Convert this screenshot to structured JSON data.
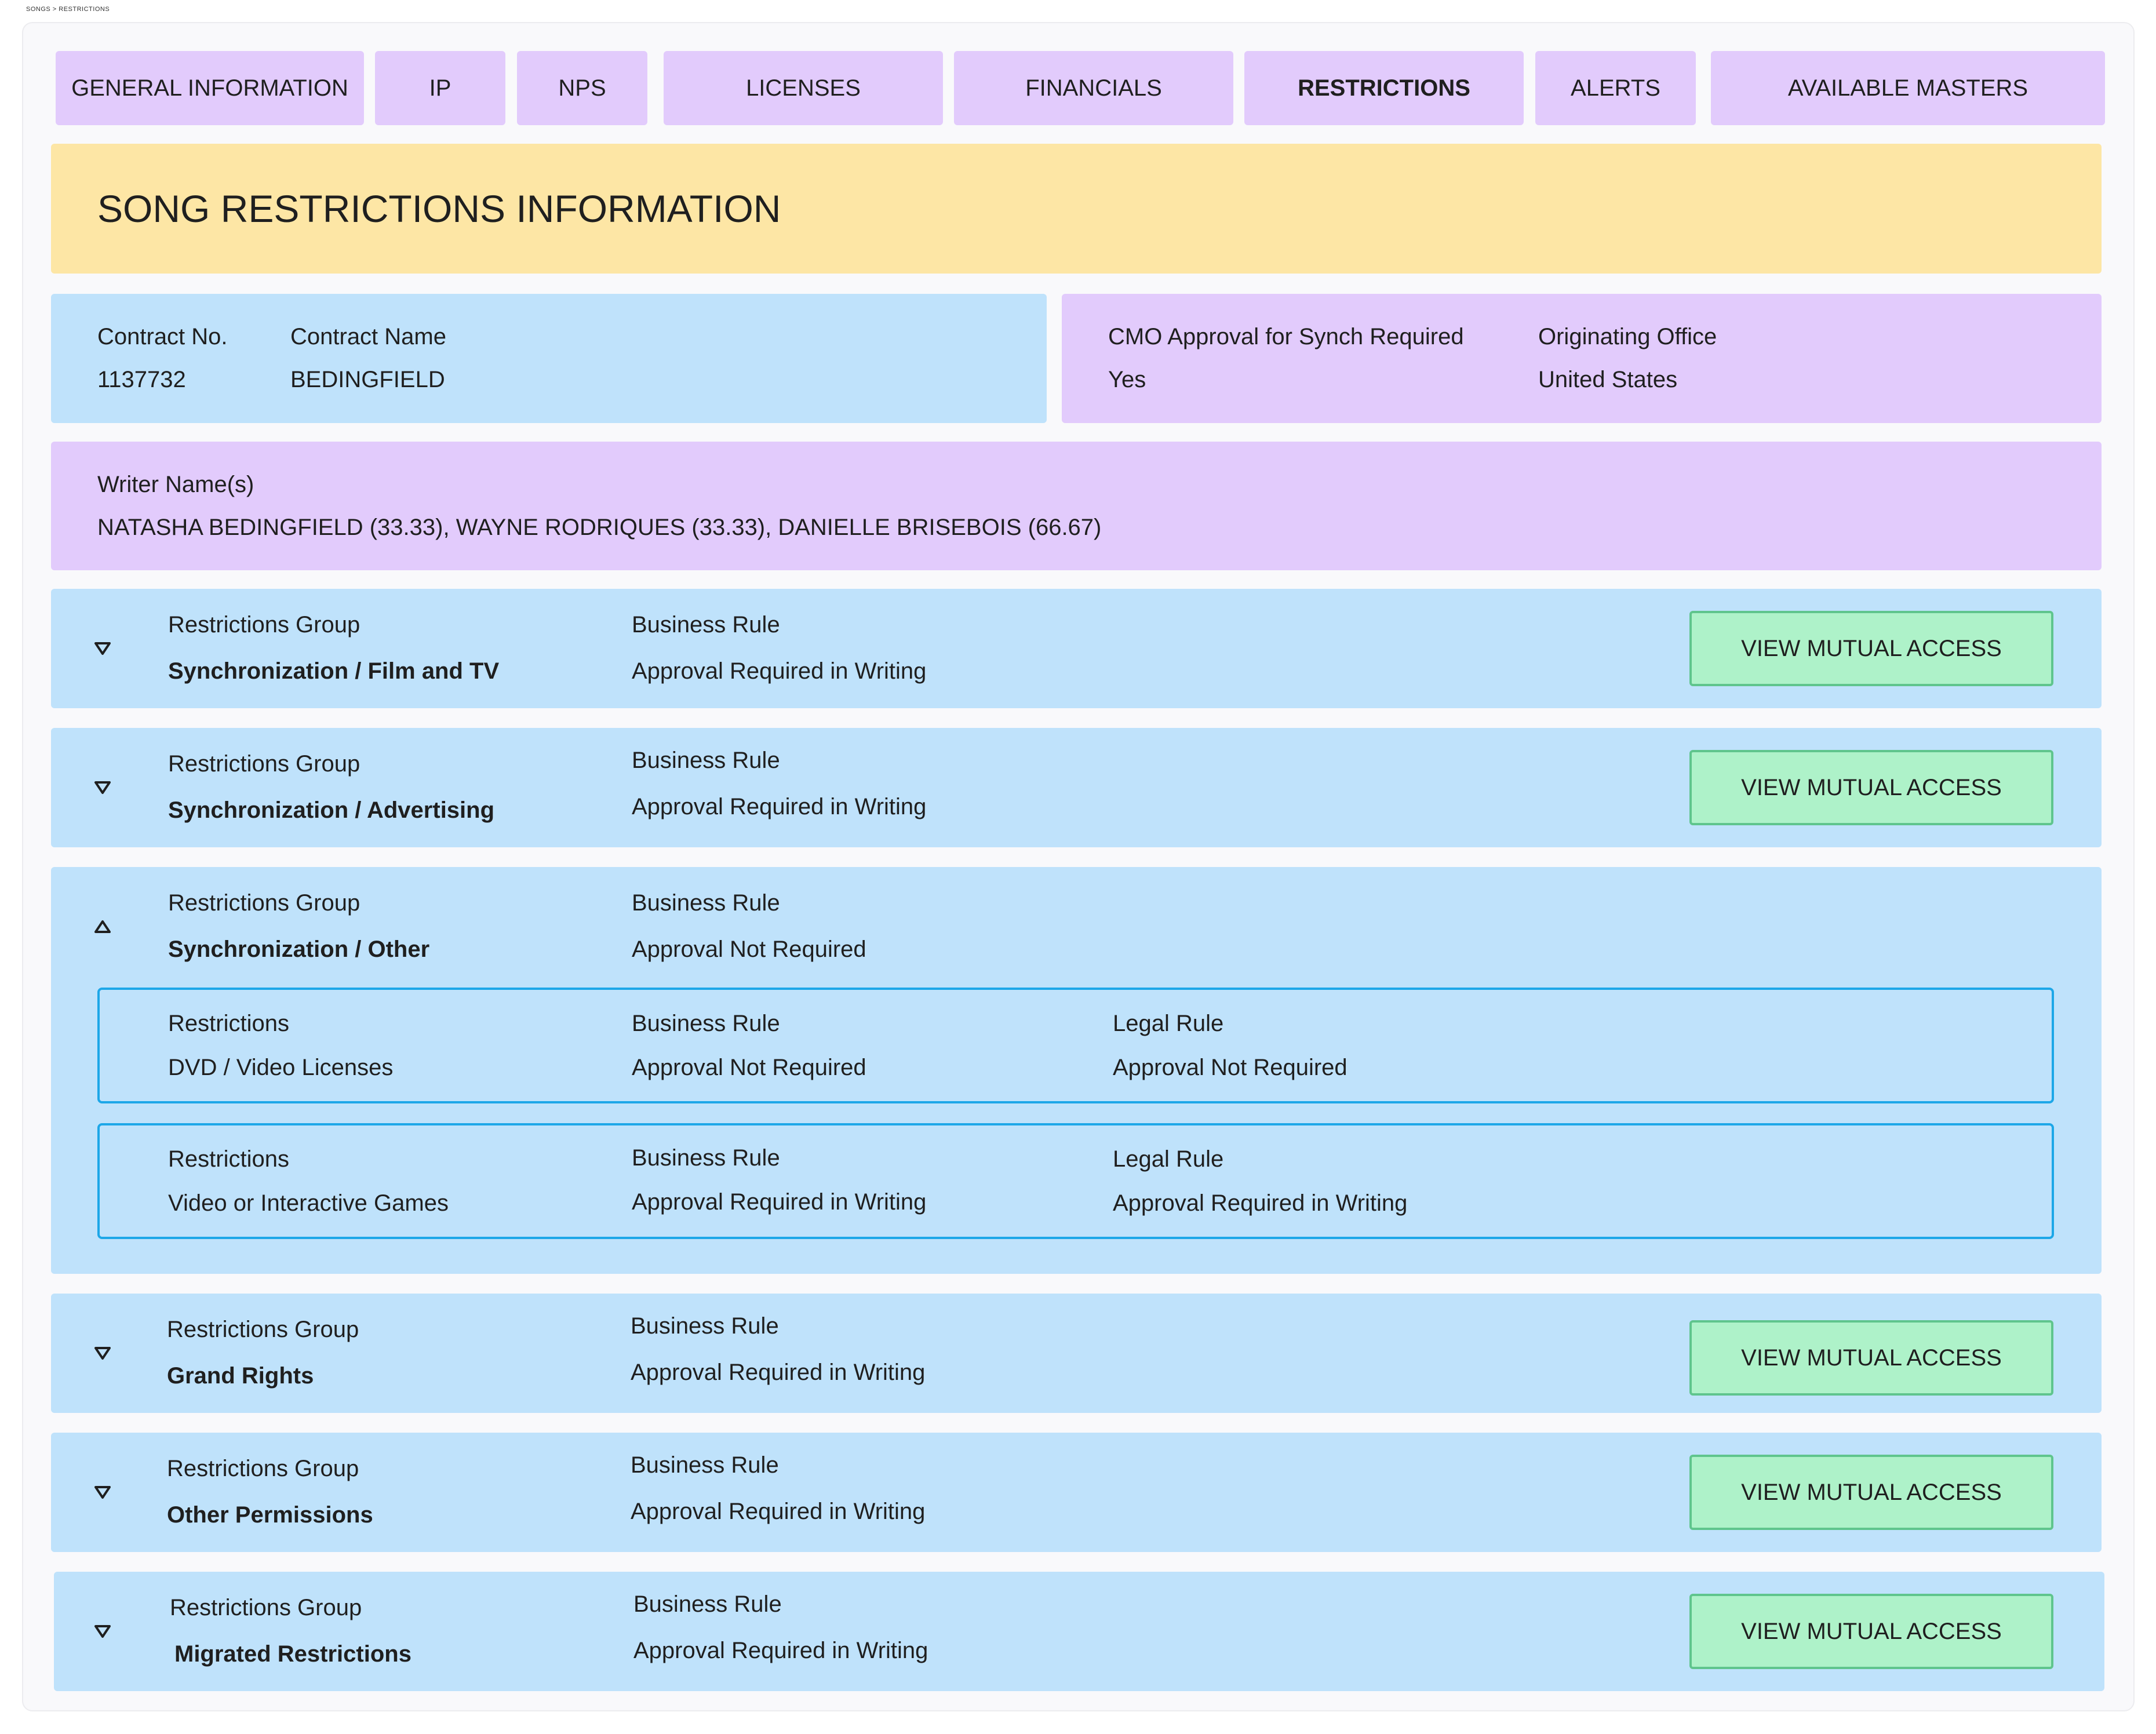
{
  "breadcrumb": "SONGS > RESTRICTIONS",
  "tabs": [
    {
      "label": "GENERAL INFORMATION"
    },
    {
      "label": "IP"
    },
    {
      "label": "NPS"
    },
    {
      "label": "LICENSES"
    },
    {
      "label": "FINANCIALS"
    },
    {
      "label": "RESTRICTIONS"
    },
    {
      "label": "ALERTS"
    },
    {
      "label": "AVAILABLE MASTERS"
    }
  ],
  "page_title": "SONG RESTRICTIONS INFORMATION",
  "contract": {
    "no_label": "Contract No.",
    "no_value": "1137732",
    "name_label": "Contract Name",
    "name_value": "BEDINGFIELD"
  },
  "approval": {
    "cmo_label": "CMO Approval for Synch Required",
    "cmo_value": "Yes",
    "office_label": "Originating Office",
    "office_value": "United States"
  },
  "writers": {
    "label": "Writer Name(s)",
    "value": "NATASHA BEDINGFIELD (33.33), WAYNE RODRIQUES (33.33), DANIELLE BRISEBOIS (66.67)"
  },
  "groups": [
    {
      "group_label": "Restrictions Group",
      "group_value": "Synchronization / Film and TV",
      "rule_label": "Business Rule",
      "rule_value": "Approval Required in Writing",
      "button": "VIEW MUTUAL ACCESS"
    },
    {
      "group_label": "Restrictions Group",
      "group_value": "Synchronization / Advertising",
      "rule_label": "Business Rule",
      "rule_value": "Approval Required in Writing",
      "button": "VIEW MUTUAL ACCESS"
    },
    {
      "group_label": "Restrictions Group",
      "group_value": "Synchronization / Other",
      "rule_label": "Business Rule",
      "rule_value": "Approval Not Required",
      "restrictions": [
        {
          "r_label": "Restrictions",
          "r_value": "DVD / Video Licenses",
          "b_label": "Business Rule",
          "b_value": "Approval Not Required",
          "l_label": "Legal Rule",
          "l_value": "Approval Not Required"
        },
        {
          "r_label": "Restrictions",
          "r_value": "Video or Interactive Games",
          "b_label": "Business Rule",
          "b_value": "Approval Required in Writing",
          "l_label": "Legal Rule",
          "l_value": "Approval Required in Writing"
        }
      ]
    },
    {
      "group_label": "Restrictions Group",
      "group_value": "Grand Rights",
      "rule_label": "Business Rule",
      "rule_value": "Approval Required in Writing",
      "button": "VIEW MUTUAL ACCESS"
    },
    {
      "group_label": "Restrictions Group",
      "group_value": "Other Permissions",
      "rule_label": "Business Rule",
      "rule_value": "Approval Required in Writing",
      "button": "VIEW MUTUAL ACCESS"
    },
    {
      "group_label": "Restrictions Group",
      "group_value": "Migrated Restrictions",
      "rule_label": "Business Rule",
      "rule_value": "Approval Required in Writing",
      "button": "VIEW MUTUAL ACCESS"
    }
  ],
  "colors": {
    "tab_bg": "#e2cbfc",
    "banner_bg": "#fde6a5",
    "panel_blue": "#bfe2fb",
    "panel_purple": "#e2cbfc",
    "button_green": "#aef2c9",
    "button_border": "#5fc58d",
    "inner_border": "#1da7e8"
  },
  "icons": {
    "expand": "triangle-down-icon",
    "collapse": "triangle-up-icon"
  }
}
